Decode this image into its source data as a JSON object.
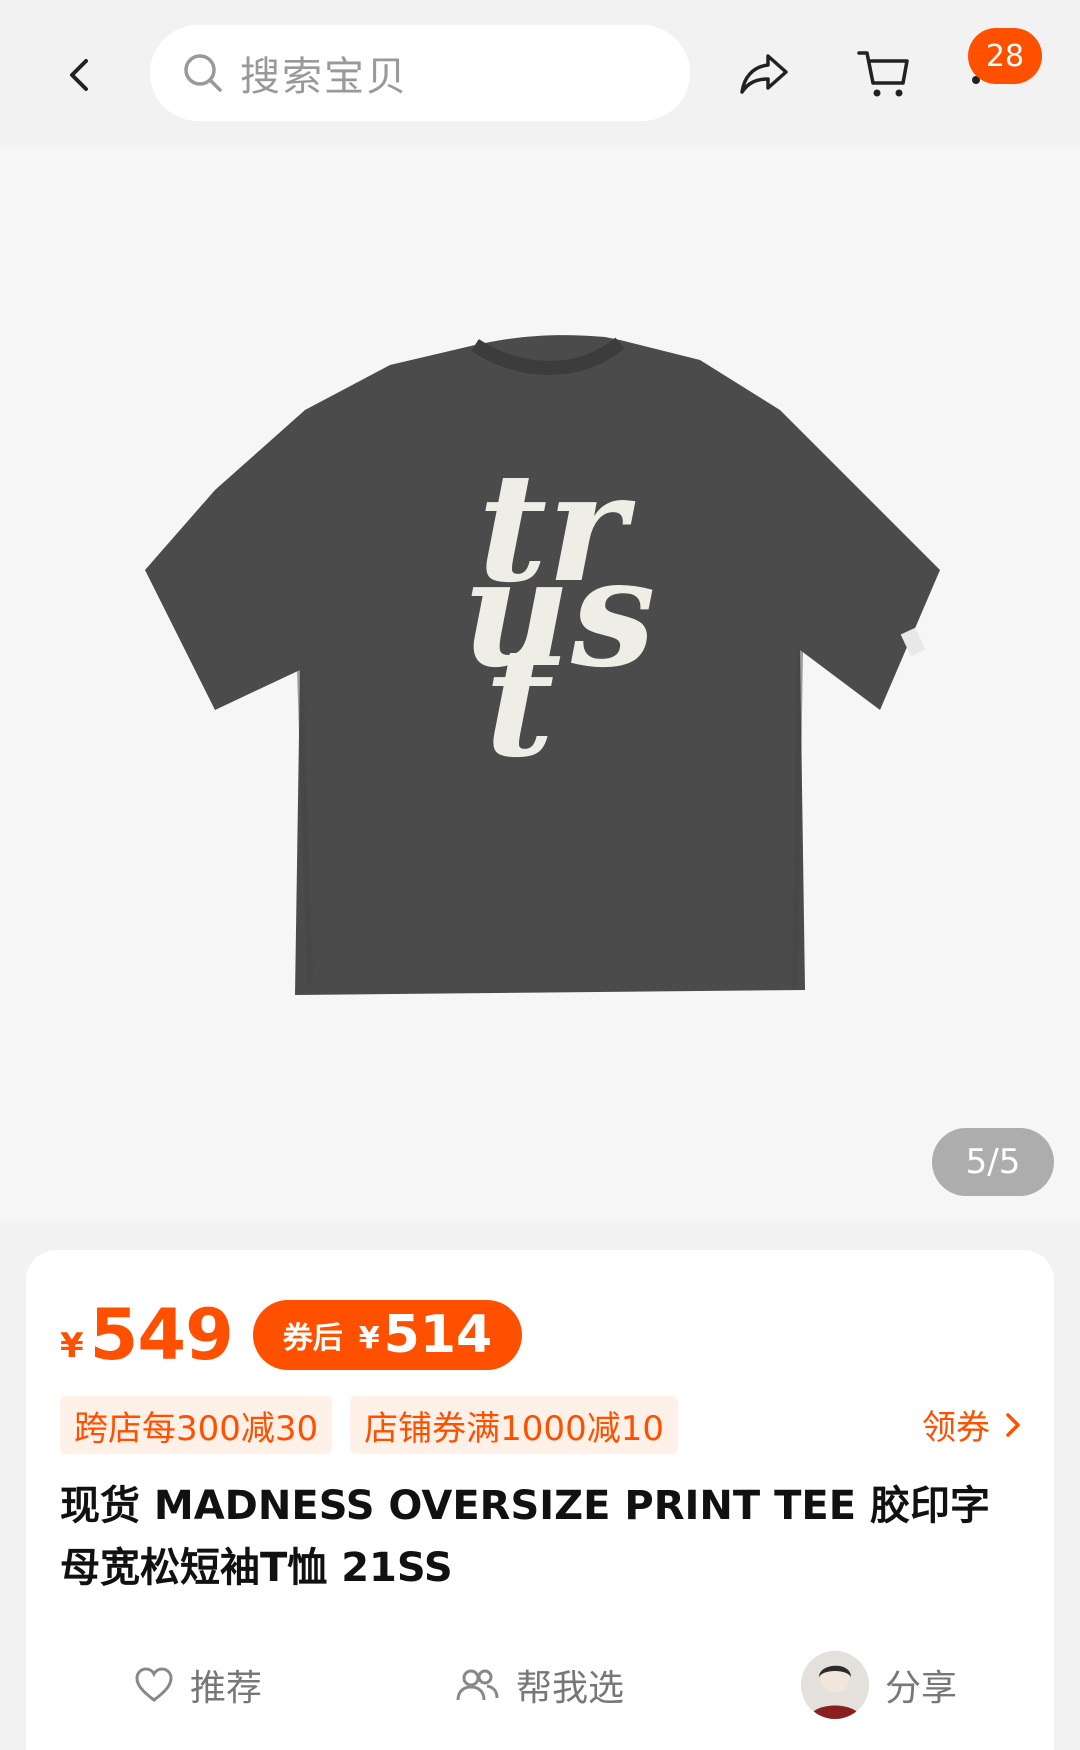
{
  "header": {
    "search_placeholder": "搜索宝贝",
    "cart_badge": "28",
    "icons": {
      "back": "chevron-left-icon",
      "search": "search-icon",
      "share": "share-arrow-icon",
      "cart": "cart-icon",
      "more": "more-icon"
    }
  },
  "gallery": {
    "page_indicator": "5/5",
    "product_print_text": [
      "tr",
      "us",
      "t"
    ]
  },
  "pricing": {
    "currency": "¥",
    "price": "549",
    "after_coupon_label": "券后",
    "after_coupon_currency": "¥",
    "after_coupon_price": "514",
    "accent_color": "#ff5000"
  },
  "promotions": {
    "tags": [
      "跨店每300减30",
      "店铺券满1000减10"
    ],
    "claim_label": "领券"
  },
  "product": {
    "title": "现货 MADNESS OVERSIZE PRINT TEE 胶印字母宽松短袖T恤 21SS"
  },
  "actions": {
    "recommend_label": "推荐",
    "help_choose_label": "帮我选",
    "share_label": "分享"
  }
}
